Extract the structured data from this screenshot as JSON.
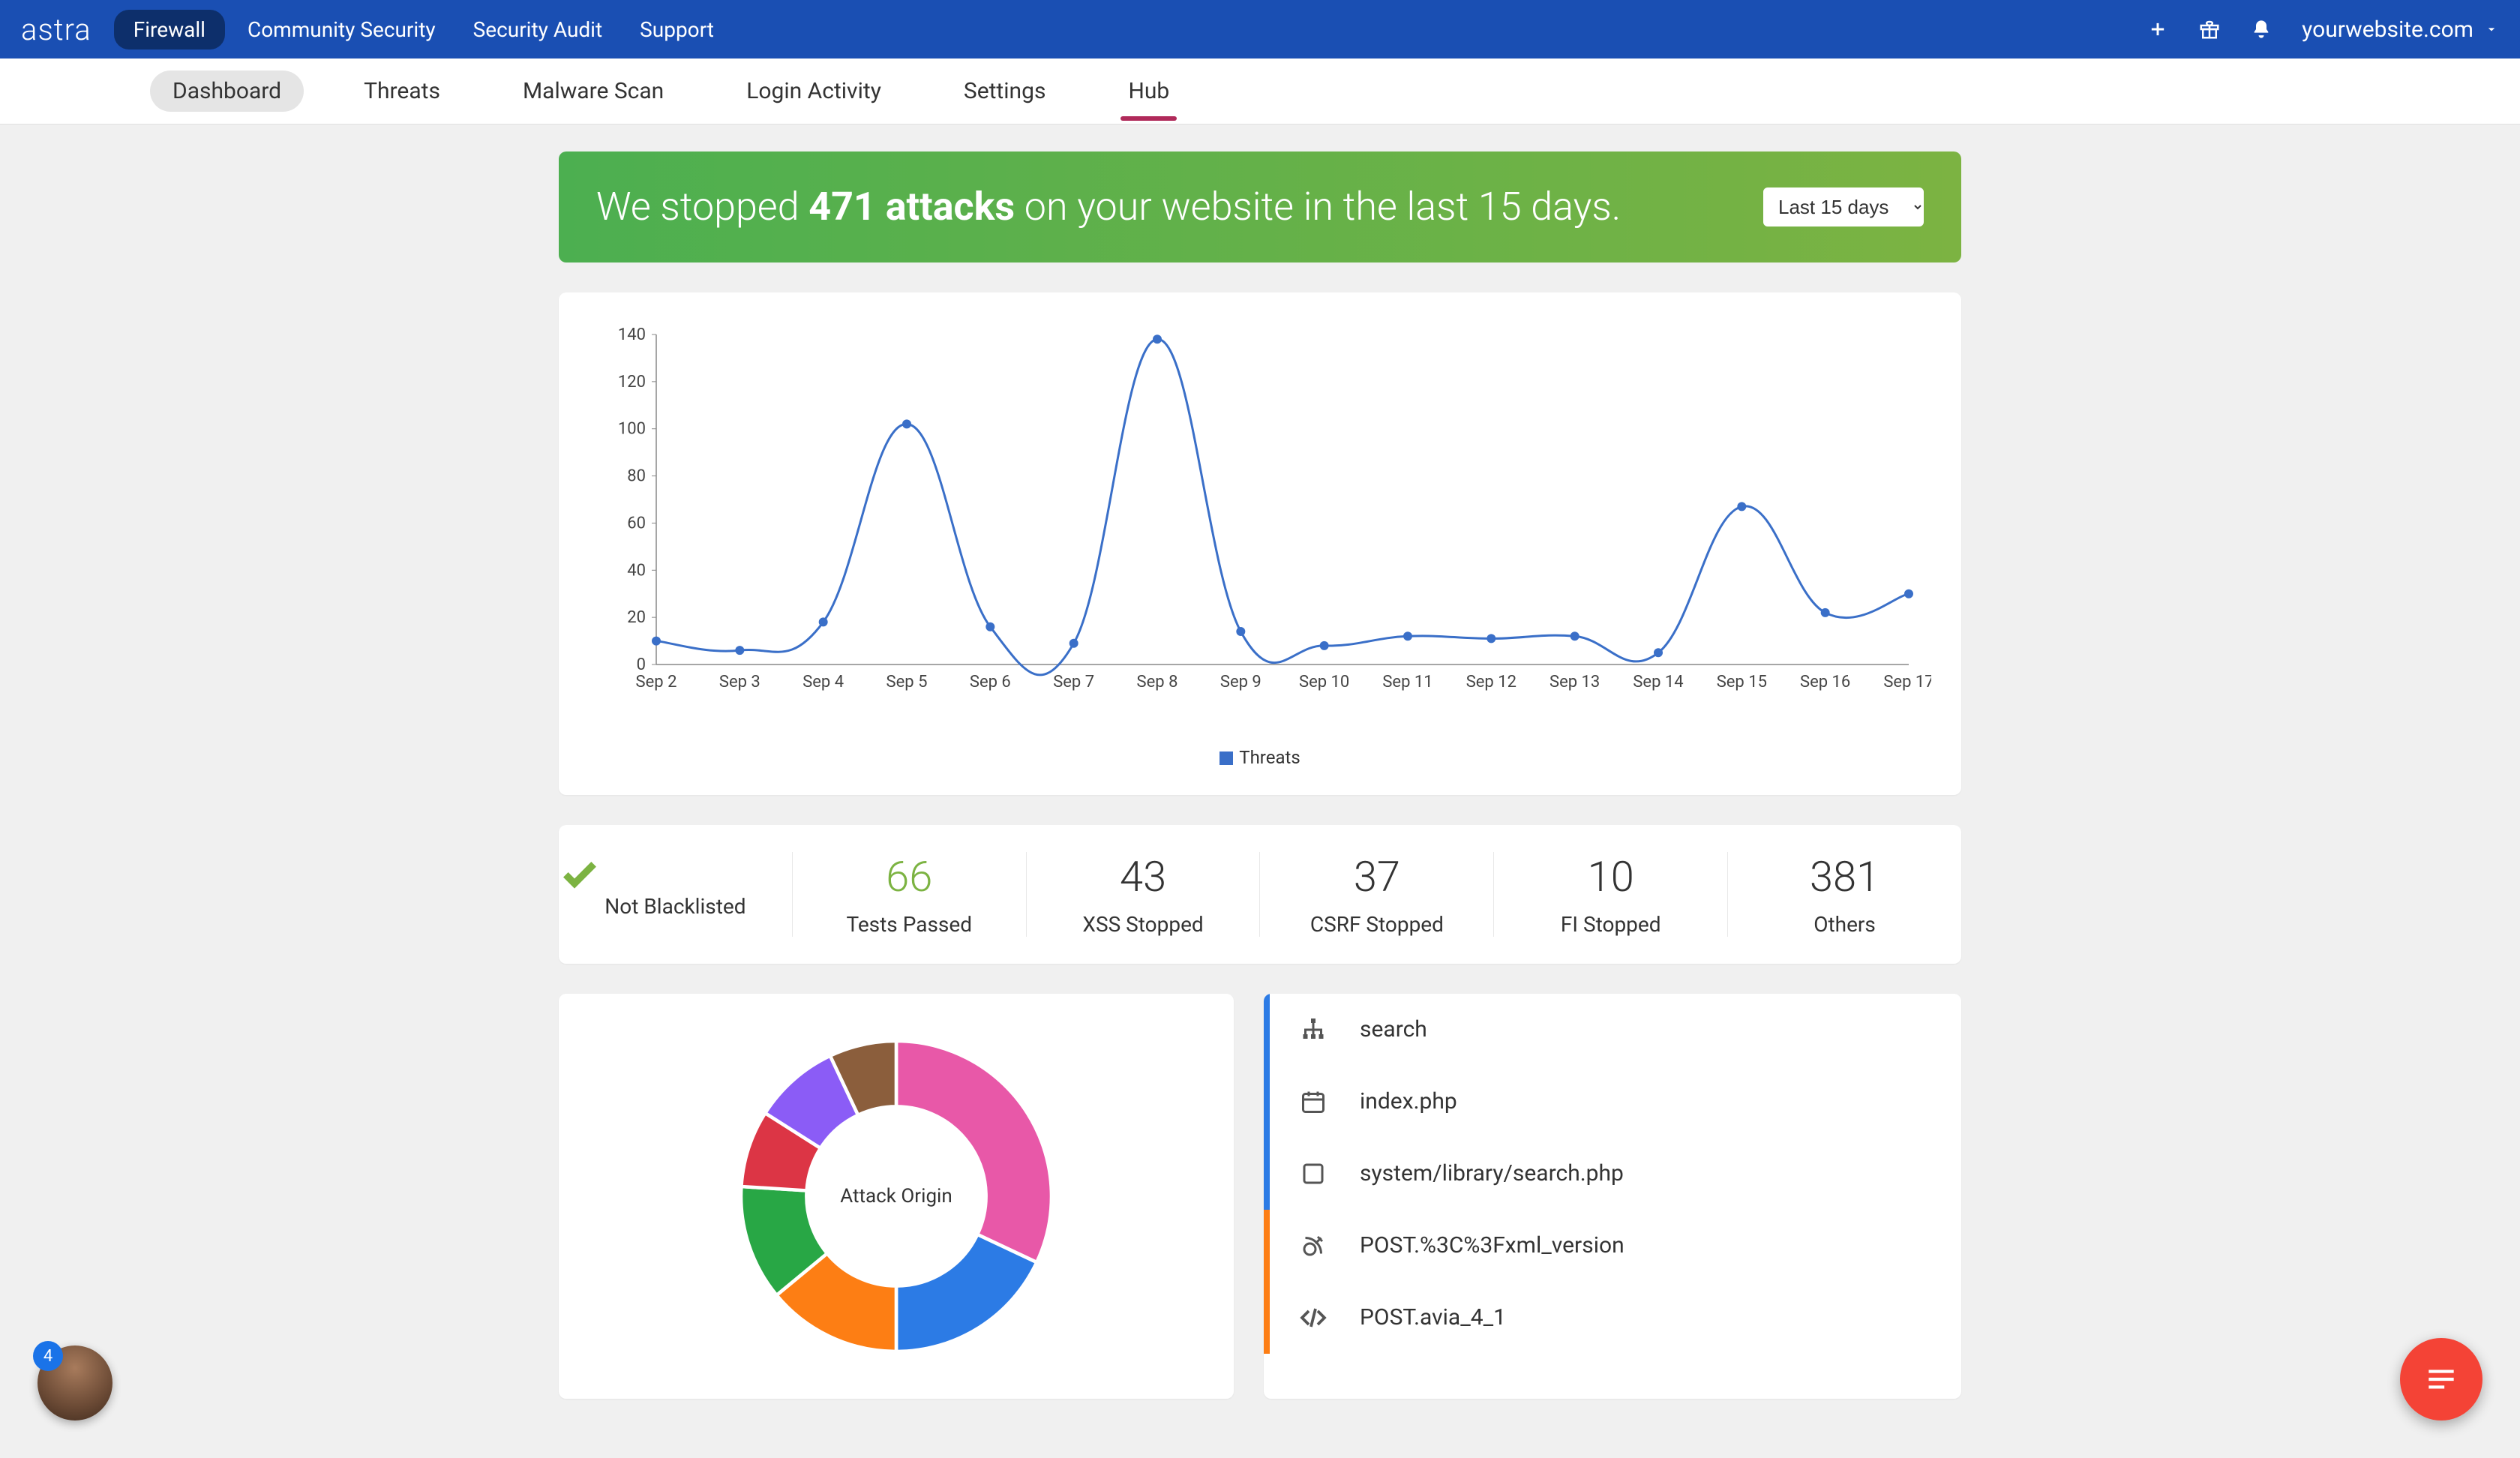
{
  "topbar": {
    "logo": "astra",
    "primary_pill": "Firewall",
    "links": [
      "Community Security",
      "Security Audit",
      "Support"
    ],
    "site_label": "yourwebsite.com"
  },
  "subtabs": [
    "Dashboard",
    "Threats",
    "Malware Scan",
    "Login Activity",
    "Settings",
    "Hub"
  ],
  "subtab_active_index": 0,
  "banner": {
    "prefix": "We stopped ",
    "count_text": "471 attacks",
    "suffix": " on your website in the last 15 days.",
    "dropdown_selected": "Last 15 days"
  },
  "chart_data": {
    "type": "line",
    "title": "",
    "xlabel": "",
    "ylabel": "",
    "ylim": [
      0,
      140
    ],
    "yticks": [
      0,
      20,
      40,
      60,
      80,
      100,
      120,
      140
    ],
    "categories": [
      "Sep 2",
      "Sep 3",
      "Sep 4",
      "Sep 5",
      "Sep 6",
      "Sep 7",
      "Sep 8",
      "Sep 9",
      "Sep 10",
      "Sep 11",
      "Sep 12",
      "Sep 13",
      "Sep 14",
      "Sep 15",
      "Sep 16",
      "Sep 17"
    ],
    "series": [
      {
        "name": "Threats",
        "values": [
          10,
          6,
          18,
          102,
          16,
          9,
          138,
          14,
          8,
          12,
          11,
          12,
          5,
          67,
          22,
          30
        ],
        "color": "#3a6fc8"
      }
    ]
  },
  "stats": [
    {
      "value": "✓",
      "label": "Not Blacklisted",
      "is_icon": true
    },
    {
      "value": "66",
      "label": "Tests Passed",
      "green": true
    },
    {
      "value": "43",
      "label": "XSS Stopped"
    },
    {
      "value": "37",
      "label": "CSRF Stopped"
    },
    {
      "value": "10",
      "label": "FI Stopped"
    },
    {
      "value": "381",
      "label": "Others"
    }
  ],
  "donut": {
    "center_label": "Attack Origin",
    "slices": [
      {
        "value": 32,
        "color": "#e858a8"
      },
      {
        "value": 18,
        "color": "#2c7be5"
      },
      {
        "value": 14,
        "color": "#fd7e14"
      },
      {
        "value": 12,
        "color": "#28a745"
      },
      {
        "value": 8,
        "color": "#dc3545"
      },
      {
        "value": 9,
        "color": "#8b5cf6"
      },
      {
        "value": 7,
        "color": "#8b5e3c"
      }
    ]
  },
  "attack_list": [
    {
      "icon": "sitemap",
      "label": "search",
      "accent": "#2c7be5"
    },
    {
      "icon": "calendar",
      "label": "index.php",
      "accent": "#2c7be5"
    },
    {
      "icon": "square",
      "label": "system/library/search.php",
      "accent": "#2c7be5"
    },
    {
      "icon": "satellite",
      "label": "POST.%3C%3Fxml_version",
      "accent": "#fd7e14"
    },
    {
      "icon": "code",
      "label": "POST.avia_4_1",
      "accent": "#fd7e14"
    }
  ],
  "avatar_badge": "4"
}
